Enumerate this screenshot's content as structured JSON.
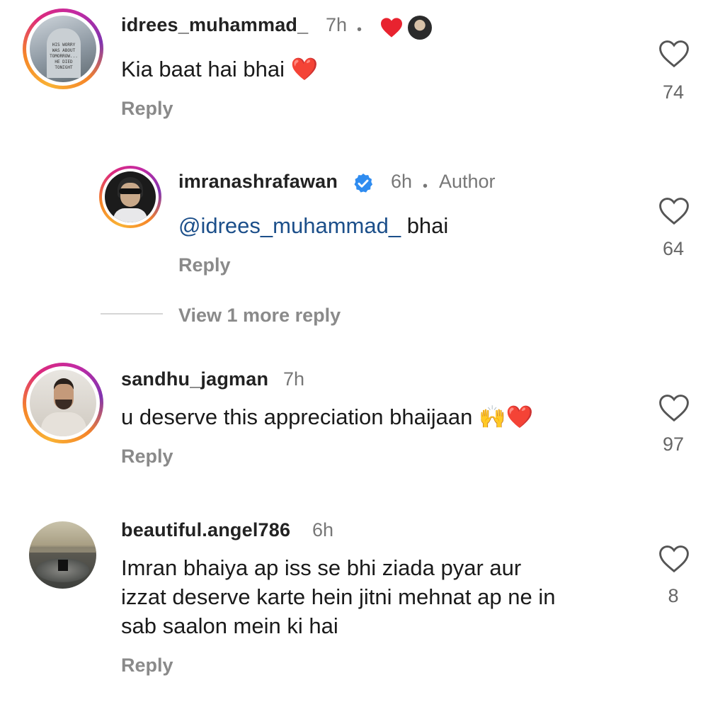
{
  "comments": [
    {
      "username": "idrees_muhammad_",
      "time": "7h",
      "text": "Kia baat hai bhai",
      "emoji": "❤️",
      "reply_label": "Reply",
      "likes": "74",
      "avatar_text": [
        "HIS WORRY",
        "WAS ABOUT",
        "TOMORROW...",
        "HE DIED",
        "TONIGHT"
      ]
    },
    {
      "username": "sandhu_jagman",
      "time": "7h",
      "text": "u deserve this appreciation bhaijaan",
      "emoji": "🙌❤️",
      "reply_label": "Reply",
      "likes": "97"
    },
    {
      "username": "beautiful.angel786",
      "time": "6h",
      "text_lines": [
        "Imran bhaiya ap iss se bhi ziada pyar aur",
        "izzat deserve karte hein jitni mehnat ap ne in",
        "sab saalon mein ki hai"
      ],
      "reply_label": "Reply",
      "likes": "8"
    }
  ],
  "author_reply": {
    "username": "imranashrafawan",
    "time": "6h",
    "author_label": "Author",
    "mention": "@idrees_muhammad_",
    "text": "bhai",
    "reply_label": "Reply",
    "likes": "64"
  },
  "view_more": "View 1 more reply",
  "colors": {
    "heart": "#e8232f",
    "verified": "#2f8cf0",
    "mention": "#1c4f8a"
  }
}
